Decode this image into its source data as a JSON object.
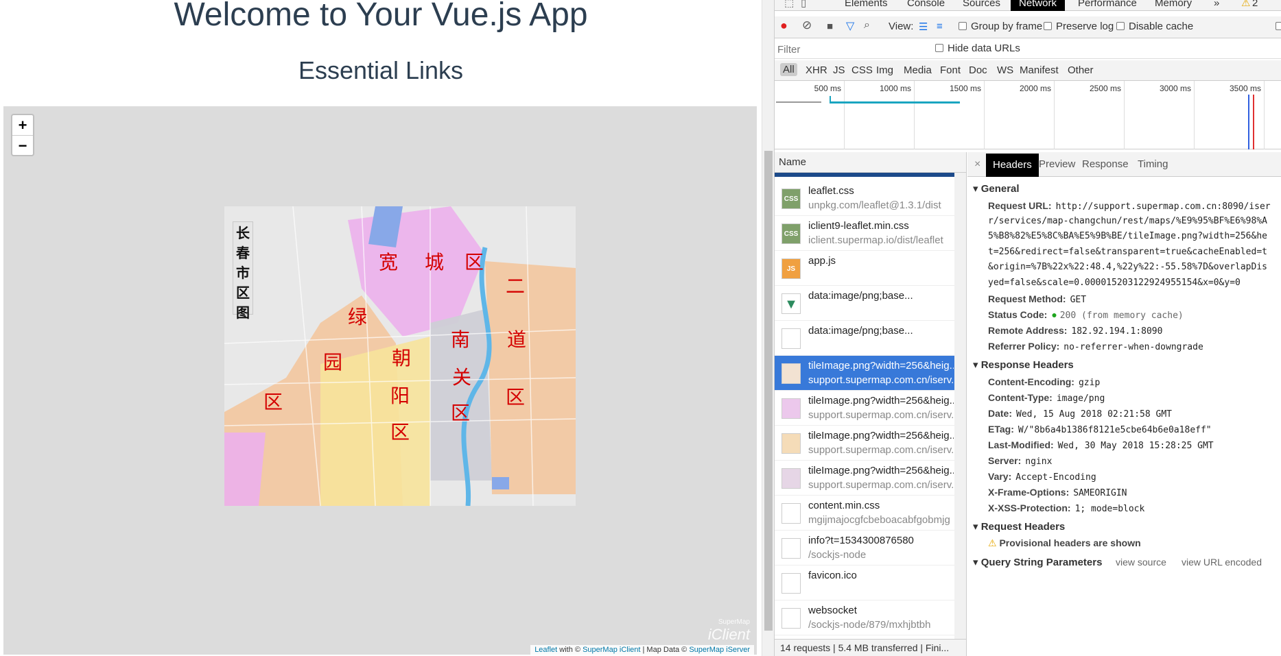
{
  "page": {
    "title": "Welcome to Your Vue.js App",
    "subtitle": "Essential Links"
  },
  "map": {
    "zoom_in": "+",
    "zoom_out": "−",
    "title_chars": [
      "长",
      "春",
      "市",
      "区",
      "图"
    ],
    "districts": [
      "宽",
      "城",
      "区",
      "二",
      "道",
      "区",
      "绿",
      "园",
      "区",
      "朝",
      "阳",
      "区",
      "南",
      "关",
      "区"
    ],
    "attribution": {
      "leaflet": "Leaflet",
      "with": "with ©",
      "iclient": "SuperMap iClient",
      "sep": "| Map Data ©",
      "iserver": "SuperMap iServer"
    },
    "watermark_small": "SuperMap",
    "watermark_big": "iClient"
  },
  "devtools": {
    "tabs": [
      "Elements",
      "Console",
      "Sources",
      "Network",
      "Performance",
      "Memory"
    ],
    "active_tab": "Network",
    "more_tabs": "»",
    "warning_count": "2",
    "toolbar": {
      "view_label": "View:",
      "group_by_frame": "Group by frame",
      "preserve_log": "Preserve log",
      "disable_cache": "Disable cache"
    },
    "filter": {
      "placeholder": "Filter",
      "hide_data_urls": "Hide data URLs"
    },
    "types": [
      "All",
      "XHR",
      "JS",
      "CSS",
      "Img",
      "Media",
      "Font",
      "Doc",
      "WS",
      "Manifest",
      "Other"
    ],
    "timeline_ticks": [
      "500 ms",
      "1000 ms",
      "1500 ms",
      "2000 ms",
      "2500 ms",
      "3000 ms",
      "3500 ms"
    ],
    "name_header": "Name",
    "requests": [
      {
        "name": "leaflet.css",
        "sub": "unpkg.com/leaflet@1.3.1/dist",
        "icon": "css-file-icon",
        "selected": false
      },
      {
        "name": "iclient9-leaflet.min.css",
        "sub": "iclient.supermap.io/dist/leaflet",
        "icon": "css-file-icon",
        "selected": false
      },
      {
        "name": "app.js",
        "sub": "",
        "icon": "js-file-icon",
        "selected": false
      },
      {
        "name": "data:image/png;base...",
        "sub": "",
        "icon": "vue-logo-icon",
        "selected": false
      },
      {
        "name": "data:image/png;base...",
        "sub": "",
        "icon": "blank-file-icon",
        "selected": false
      },
      {
        "name": "tileImage.png?width=256&heig...",
        "sub": "support.supermap.com.cn/iserv...",
        "icon": "map-tile-icon",
        "selected": true
      },
      {
        "name": "tileImage.png?width=256&heig...",
        "sub": "support.supermap.com.cn/iserv...",
        "icon": "map-tile-icon",
        "selected": false
      },
      {
        "name": "tileImage.png?width=256&heig...",
        "sub": "support.supermap.com.cn/iserv...",
        "icon": "map-tile-icon",
        "selected": false
      },
      {
        "name": "tileImage.png?width=256&heig...",
        "sub": "support.supermap.com.cn/iserv...",
        "icon": "map-tile-icon",
        "selected": false
      },
      {
        "name": "content.min.css",
        "sub": "mgijmajocgfcbeboacabfgobmjg",
        "icon": "blank-file-icon",
        "selected": false
      },
      {
        "name": "info?t=1534300876580",
        "sub": "/sockjs-node",
        "icon": "blank-file-icon",
        "selected": false
      },
      {
        "name": "favicon.ico",
        "sub": "",
        "icon": "blank-file-icon",
        "selected": false
      },
      {
        "name": "websocket",
        "sub": "/sockjs-node/879/mxhjbtbh",
        "icon": "blank-file-icon",
        "selected": false
      }
    ],
    "status": "14 requests  |  5.4 MB transferred  |  Fini...",
    "detail_tabs": [
      "Headers",
      "Preview",
      "Response",
      "Timing"
    ],
    "active_detail_tab": "Headers",
    "general": {
      "title": "General",
      "request_url_label": "Request URL:",
      "request_url_lines": [
        "http://support.supermap.com.cn:8090/iser",
        "r/services/map-changchun/rest/maps/%E9%95%BF%E6%98%A",
        "5%B8%82%E5%8C%BA%E5%9B%BE/tileImage.png?width=256&he",
        "t=256&redirect=false&transparent=true&cacheEnabled=t",
        "&origin=%7B%22x%22:48.4,%22y%22:-55.58%7D&overlapDis",
        "yed=false&scale=0.000015203122924955154&x=0&y=0"
      ],
      "method_label": "Request Method:",
      "method": "GET",
      "status_label": "Status Code:",
      "status": "200  (from memory cache)",
      "remote_label": "Remote Address:",
      "remote": "182.92.194.1:8090",
      "referrer_label": "Referrer Policy:",
      "referrer": "no-referrer-when-downgrade"
    },
    "response_headers": {
      "title": "Response Headers",
      "items": [
        {
          "k": "Content-Encoding:",
          "v": "gzip"
        },
        {
          "k": "Content-Type:",
          "v": "image/png"
        },
        {
          "k": "Date:",
          "v": "Wed, 15 Aug 2018 02:21:58 GMT"
        },
        {
          "k": "ETag:",
          "v": "W/\"8b6a4b1386f8121e5cbe64b6e0a18eff\""
        },
        {
          "k": "Last-Modified:",
          "v": "Wed, 30 May 2018 15:28:25 GMT"
        },
        {
          "k": "Server:",
          "v": "nginx"
        },
        {
          "k": "Vary:",
          "v": "Accept-Encoding"
        },
        {
          "k": "X-Frame-Options:",
          "v": "SAMEORIGIN"
        },
        {
          "k": "X-XSS-Protection:",
          "v": "1; mode=block"
        }
      ]
    },
    "request_headers": {
      "title": "Request Headers",
      "provisional": "Provisional headers are shown"
    },
    "query_params": {
      "title": "Query String Parameters",
      "view_source": "view source",
      "view_url_encoded": "view URL encoded"
    },
    "colors": {
      "selected": "#3879d9",
      "active_tab_bg": "#000000",
      "district_text": "#d40000",
      "status_ok": "#1fa51f"
    }
  }
}
